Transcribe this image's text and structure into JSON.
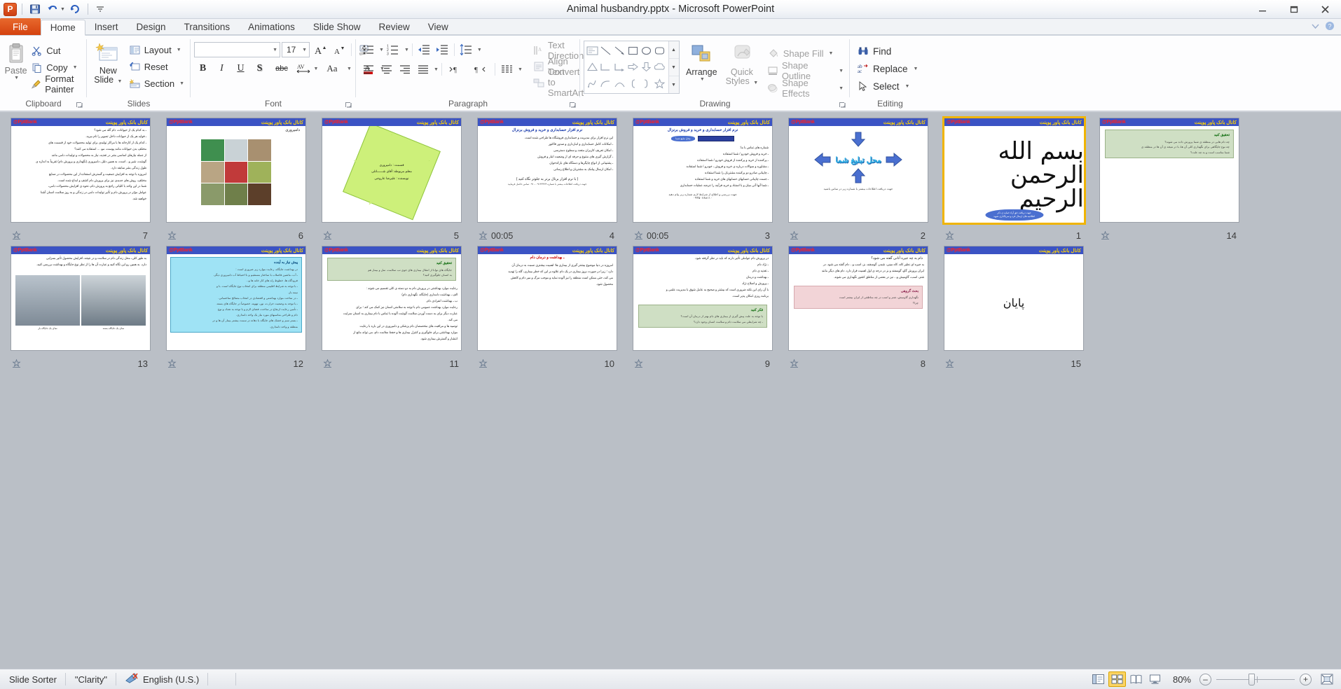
{
  "window": {
    "title": "Animal husbandry.pptx  -  Microsoft PowerPoint",
    "minimize": "–",
    "maximize": "□",
    "close": "✕"
  },
  "quick_access": {
    "app_label": "P",
    "save": "save-icon",
    "undo": "undo-icon",
    "redo": "redo-icon",
    "customize": "customize-icon"
  },
  "tabs": [
    {
      "label": "File",
      "id": "file"
    },
    {
      "label": "Home",
      "id": "home"
    },
    {
      "label": "Insert",
      "id": "insert"
    },
    {
      "label": "Design",
      "id": "design"
    },
    {
      "label": "Transitions",
      "id": "transitions"
    },
    {
      "label": "Animations",
      "id": "animations"
    },
    {
      "label": "Slide Show",
      "id": "slideshow"
    },
    {
      "label": "Review",
      "id": "review"
    },
    {
      "label": "View",
      "id": "view"
    }
  ],
  "ribbon": {
    "clipboard": {
      "name": "Clipboard",
      "paste": "Paste",
      "cut": "Cut",
      "copy": "Copy",
      "format_painter": "Format Painter"
    },
    "slides": {
      "name": "Slides",
      "new_slide": "New\nSlide",
      "new_slide_line1": "New",
      "new_slide_line2": "Slide",
      "layout": "Layout",
      "reset": "Reset",
      "section": "Section"
    },
    "font": {
      "name": "Font",
      "font_family_value": "",
      "font_size_value": "17",
      "bold": "B",
      "italic": "I",
      "underline": "U",
      "shadow": "S",
      "strikethrough": "abc",
      "character_spacing": "AV",
      "change_case": "Aa",
      "font_color": "A",
      "grow_font": "A",
      "shrink_font": "A",
      "clear_formatting": "Aa"
    },
    "paragraph": {
      "name": "Paragraph",
      "text_direction": "Text Direction",
      "align_text": "Align Text",
      "convert_to_smartart": "Convert to SmartArt"
    },
    "drawing": {
      "name": "Drawing",
      "arrange": "Arrange",
      "quick_styles_line1": "Quick",
      "quick_styles_line2": "Styles",
      "shape_fill": "Shape Fill",
      "shape_outline": "Shape Outline",
      "shape_effects": "Shape Effects"
    },
    "editing": {
      "name": "Editing",
      "find": "Find",
      "replace": "Replace",
      "select": "Select"
    }
  },
  "slide_banner": {
    "left": "@PptBank",
    "right": "کانال بانک پاور پوینت"
  },
  "slides": [
    {
      "number": "7",
      "type": "text",
      "timing": "",
      "lines": [
        "ـ به کدام یک از حیوانات، دام گله می شود؟",
        "ـ فواید هر یک از حیوانات داخل تصویر را نام ببرید.",
        "ـ کدام یک از کارخانه ها با مراکز تولیدی برای تولید محصولات خود از قسمت های",
        "مختلف بدن حیوانات مانند پوست، مو، ... استفاده می کنند؟",
        "از جمله نیازهای اساسی بشر در تغذیه، نیاز به محصولات و تولیدات دامی مانند",
        "گوشت، شیر و... است، به همین دلیل، دامپروری (نگهداری و پرورش دام) تقریباً به اندازه ی",
        "طول زندگی بشر سابقه دارد.",
        "امروزه با توجه به افزایش جمعیت و گسترش استفاده از این محصولات در صنایع",
        "مختلف، روش های جدیدی نیز برای پرورش دام کشف و ابداع شده است.",
        "شما در این واحد با کلیاتی راجع به پرورش دام، نحوه ی افزایش محصولات دامی،",
        "عوامل مؤثر در پرورش دام و تأثیر تولیدات دامی در زندگی و به روز سلامت انسان آشنا",
        "خواهید شد."
      ]
    },
    {
      "number": "6",
      "type": "photos",
      "timing": "",
      "title": "دامپروری",
      "photo_colors": [
        "#3f8f4f",
        "#c9d2d6",
        "#a89070",
        "#b9a584",
        "#c13a3a",
        "#9fb25a",
        "#8a9a6a",
        "#6f7f4a",
        "#5c3f2a"
      ]
    },
    {
      "number": "5",
      "type": "sunburst",
      "timing": "",
      "lines": [
        "قسمت  : دامپروری",
        "معلم مربوطه: آقای  شــــــانلی",
        "نویسنده : علیرضا عاروجی"
      ]
    },
    {
      "number": "4",
      "type": "textdense",
      "timing": "00:05",
      "title": "نرم افزار حسابداری و خرید و فروش برنزال",
      "lines": [
        "این نرم افزار برای مدیریت و حسابداری فروشگاه ها طراحی شده است.",
        "ـ امکانات کامل حسابداری و انبارداری و صدور فاکتور",
        "ـ امکان تعریف کاربران متعدد و سطوح دسترسی",
        "ـ گزارش گیری های متنوع و حرفه ای از وضعیت انبار و فروش",
        "ـ پشتیبانی از انواع چاپگرها و دستگاه های بارکدخوان",
        "ـ امکان ارسال پیامک به مشتریان و اطلاع رسانی"
      ],
      "boxline": "( با نرم افزار برنال برتر به جلوتر نگاه کنید )",
      "footer": "جهت دریافت اطلاعات بیشتر با شماره ۰۹۱۴۴۴۲۳ ـ ۰۹۱ تماس حاصل فرمایید"
    },
    {
      "number": "3",
      "type": "advert",
      "timing": "00:05",
      "title": "نرم افزار حسابداری و خرید و فروش برنزال",
      "callout": "محل تبلیغ شما",
      "lines": [
        "شماره های تماس با ما:",
        "ـ خرید و فروش خودرو / شما استفاده",
        "ـ پرکننده از خرید و پرکننده از فروش خودرو / شما استفاده",
        "ـ مشاوره و سوالات درباره ی خرید و فروش ، خودرو / شما استفاده",
        "ـ چاپبانی صادرو دو پرکننده مشتریان را شما استفاده",
        "ـ جست چاپبانی حسابهای حسابهای های خرید و شما استفاده",
        "ـ شما آنها آنی میان و با استناد و خرید فرآیند را عرضه عملیات حسابداری"
      ],
      "cta": "جهت بررسی و اطلاع از شرایط لازم شماره زیر پیام دهید",
      "phone": "۰۹۳۵۰۶۸۸۱۱۰"
    },
    {
      "number": "2",
      "type": "promo",
      "timing": "",
      "text": "محل تبلیغ شما",
      "footer": "جهت دریافت اطلاعات بیشتر با شماره زیر در تماس باشید"
    },
    {
      "number": "1",
      "type": "bismillah",
      "timing": "",
      "selected": true,
      "calligraphy": "بسم الله الرحمن الرحیم",
      "badge": "جهت دریافت حق آزاد حمایه ی ذکر\nاطلاعیه های ارسال فرد و سربگذاری شوید"
    },
    {
      "number": "14",
      "type": "greenbox",
      "timing": "",
      "box_title": "تحقیق کنید",
      "lines": [
        "چه دام هایی در منطقه ی شما پرورش داده می شوند؟",
        "چه نوع جایگاهی برای نگهداری کلی آن ها، با در نتیجه ی آن ها در منطقه ی",
        "شما مناسب است و به چه علت؟"
      ]
    },
    {
      "number": "13",
      "type": "imagestrip",
      "timing": "",
      "lines": [
        "به طور کلی، محل زندگی دام در سلامت و در نتیجه، افزایش محصول تأثیر بسزایی",
        "دارد. به همین رو این نگاه کنید و عبارت آن ها را از نظر نوع جایگاه و بهداشت بررسی کنید."
      ],
      "caption_left": "نمای یک جایگاه باز",
      "caption_right": "نمای یک جایگاه بسته"
    },
    {
      "number": "12",
      "type": "cyanbox",
      "timing": "",
      "box_title": "پیش نیاز به آینده",
      "lines": [
        "در بهداشت جایگاه، رعایت موارد زیر ضروری است :",
        "ـ آب، ماشین فاضلاب با ساختار مستقیم و با احتیاط آب دامپروری دیگر،",
        "فرودگاه ها، خطوط راه های کار خانه ها و...",
        "ـ با توجه به شرایط اقلیمی منطقه برای انتخاب نوع جایگاه است. با و",
        "نیمه باز.",
        "ـ در ساخت موارد بهداشتی و اقتصادی در انتخاب مصالح ساختمانی.",
        "ـ با توجه به وضعیت حرارت، نور، تهویه، خصوصاً در جایگاه های بسته.",
        "ـ تأمین رعایت ارتفاع در ساخت، فضای لازم و با توجه به تعداد و نوع",
        "دام و طراحی مناسبهای مورد نیاز یک واحد دامداری.",
        "ـ بستر سبز و خشک های جایگاه با دهانه در سمت بیشتر بیمار آن ها و در",
        "منطقه و واحد دامداری."
      ]
    },
    {
      "number": "11",
      "type": "greenbox",
      "timing": "",
      "box_title": "تحقیق کنید",
      "box_lines": [
        "جایگاه های توانا از انتقال بیماری های جوی تب سلامت، سل و بیمار هم",
        "به انسان جلوگیری کنید؟"
      ],
      "lines": [
        "رعایت موارد بهداشتی در پرورش دام به دو دسته ی کلی تقسیم می شوند :",
        "الف ـ بهداشت دامداری (جایگاه، نگهداری دام)",
        "ب ـ بهداشت انفرادی دام.",
        "رعایت موارد بهداشت عمومی دام با توجه به سلامتی انسان نیز کمک می کند ؛ برای",
        "عبارت دیگر برای به دست آوردن سلامت گوشت آلوده با تماس با دام بیماری به انسان سرایت",
        "می کند.",
        "توصیه ها و مراقبت های متخصصان دام پزشکی و دامپروری در این باره با رعایت",
        "موارد بهداشتی برای جلوگیری و کنترل بیماری ها و حفظ سلامت دام، می تواند مانع از",
        "انتشار و گسترش بیماری شود."
      ]
    },
    {
      "number": "10",
      "type": "text",
      "timing": "",
      "title": "ـ بهداشت و درمان دام",
      "lines": [
        "امروزه در دنیا موضوع بیشتر گیری از بیماری ها؛ اهمیت بیشتری نسبت به درمان آن",
        "دارد ؛ زیرا در صورت بروز بیماری در یک دام علاوه بر این که خطر بیماری، گله را تهدید",
        "می کند، حتی ممکن است منطقه را نیز آلوده نماید و موجب مرگ و میر دام و کاهش",
        "محصول شود."
      ]
    },
    {
      "number": "9",
      "type": "greenbox_icon",
      "timing": "",
      "lines": [
        "در پرورش دام عواملی تأثیر دارند که باید در نظر گرفته شود.",
        "ـ نژاد دام",
        "ـ تغذیه ی دام",
        "ـ بهداشت و درمان",
        "ـ پرورش و اصلاح نژاد",
        "با آن رای این نکته ضروری است که بیشتر و صحیح به عامل شوق با مدیریت علمی و",
        "برنامه ریزی امکان پذیر است."
      ],
      "box_title": "فکر کنید",
      "box_lines": [
        "با توجه به علت پیش گیری از بیماری های دام بهتر از درمان آن است؟",
        "ـ چه شرایطی می سلامت دام و سلامت انسان وجود دارد؟"
      ]
    },
    {
      "number": "8",
      "type": "pinkbox",
      "timing": "",
      "title": "دام به چه جیره آنانی گفته می شود؟",
      "lines": [
        "به جیره ای نظیر کاه، کاه مینی، شبدر، گوسفند، بز، اسب و... دام گفته می شود. در",
        "ایران پرورش گاو، گوسفند و بز در درجه ی اول اهمیت قرار دارد. دام های دیگر مانند",
        "شتر، اسب، گاومیش و... نیز در بعضی از مناطق کشور نگهداری می شوند."
      ],
      "box_title": "بحث گروهی",
      "box_lines": [
        "نگهداری گاومیش، شتر و اسب در چه مناطقی از ایران بیشتر است",
        "چرا؟"
      ]
    },
    {
      "number": "15",
      "type": "payan",
      "timing": "",
      "text": "پایان"
    }
  ],
  "status": {
    "view_mode": "Slide Sorter",
    "theme": "\"Clarity\"",
    "language": "English (U.S.)",
    "spelling_icon": "spellcheck-icon",
    "zoom_level": "80%",
    "views": [
      {
        "name": "normal-view",
        "active": false
      },
      {
        "name": "slide-sorter-view",
        "active": true
      },
      {
        "name": "reading-view",
        "active": false
      },
      {
        "name": "slide-show-view",
        "active": false
      }
    ],
    "zoom_out": "–",
    "zoom_in": "+",
    "fit_to_window": "fit-icon"
  }
}
